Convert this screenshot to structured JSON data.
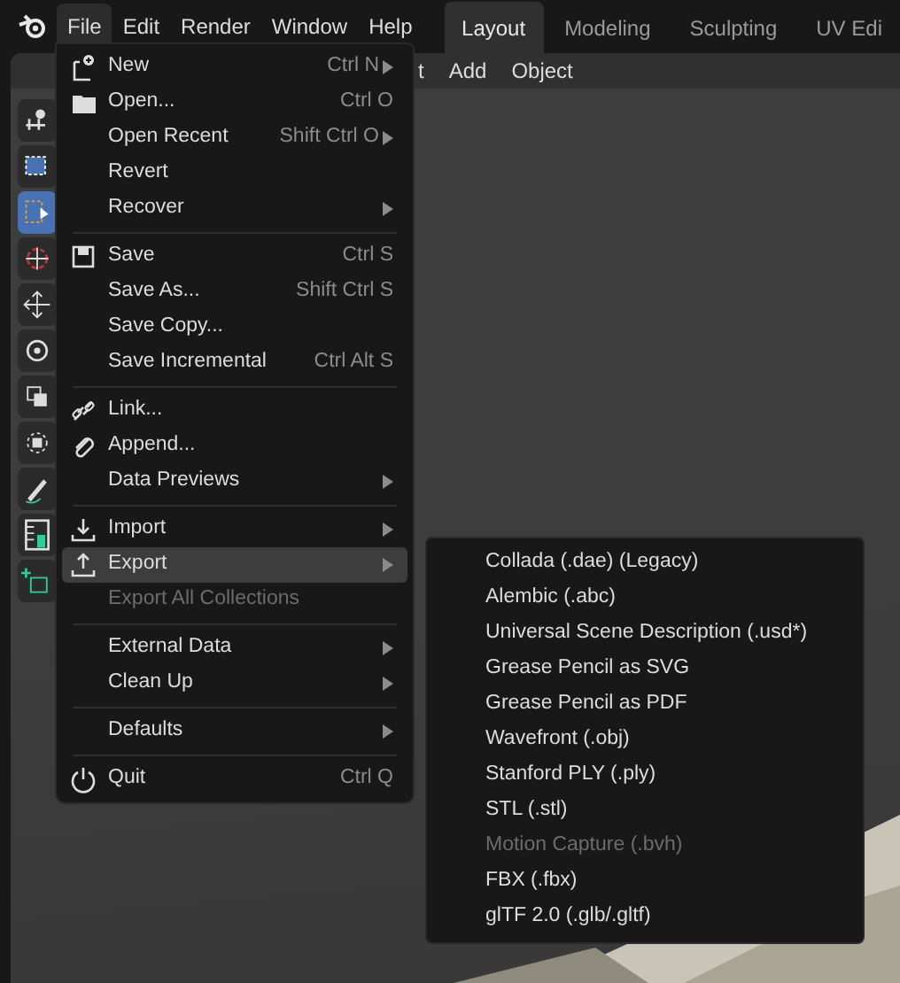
{
  "topbar": {
    "menus": [
      {
        "label": "File",
        "selected": true
      },
      {
        "label": "Edit",
        "selected": false
      },
      {
        "label": "Render",
        "selected": false
      },
      {
        "label": "Window",
        "selected": false
      },
      {
        "label": "Help",
        "selected": false
      }
    ],
    "workspaces": [
      {
        "label": "Layout",
        "selected": true
      },
      {
        "label": "Modeling",
        "selected": false
      },
      {
        "label": "Sculpting",
        "selected": false
      },
      {
        "label": "UV Edi",
        "selected": false
      }
    ]
  },
  "viewport_header": {
    "menus": [
      "t",
      "Add",
      "Object"
    ]
  },
  "toolbar": {
    "tools": [
      {
        "kind": "view",
        "selected": false
      },
      {
        "kind": "box",
        "selected": false
      },
      {
        "kind": "select",
        "selected": true
      },
      {
        "kind": "cursor",
        "selected": false
      },
      {
        "kind": "move",
        "selected": false
      },
      {
        "kind": "rotate",
        "selected": false
      },
      {
        "kind": "scale",
        "selected": false
      },
      {
        "kind": "transform",
        "selected": false
      },
      {
        "kind": "annotate",
        "selected": false
      },
      {
        "kind": "measure",
        "selected": false
      },
      {
        "kind": "add",
        "selected": false
      }
    ]
  },
  "file_menu": {
    "sections": [
      [
        {
          "label": "New",
          "kind": "new",
          "shortcut": "Ctrl N",
          "submenu": true,
          "disabled": false,
          "selected": false
        },
        {
          "label": "Open...",
          "kind": "folder",
          "shortcut": "Ctrl O",
          "submenu": false,
          "disabled": false,
          "selected": false
        },
        {
          "label": "Open Recent",
          "shortcut": "Shift Ctrl O",
          "submenu": true,
          "disabled": false,
          "selected": false
        },
        {
          "label": "Revert",
          "submenu": false,
          "disabled": false,
          "selected": false
        },
        {
          "label": "Recover",
          "submenu": true,
          "disabled": false,
          "selected": false
        }
      ],
      [
        {
          "label": "Save",
          "kind": "save",
          "shortcut": "Ctrl S",
          "submenu": false,
          "disabled": false,
          "selected": false
        },
        {
          "label": "Save As...",
          "shortcut": "Shift Ctrl S",
          "submenu": false,
          "disabled": false,
          "selected": false
        },
        {
          "label": "Save Copy...",
          "submenu": false,
          "disabled": false,
          "selected": false
        },
        {
          "label": "Save Incremental",
          "shortcut": "Ctrl Alt S",
          "submenu": false,
          "disabled": false,
          "selected": false
        }
      ],
      [
        {
          "label": "Link...",
          "kind": "link",
          "submenu": false,
          "disabled": false,
          "selected": false
        },
        {
          "label": "Append...",
          "kind": "clip",
          "submenu": false,
          "disabled": false,
          "selected": false
        },
        {
          "label": "Data Previews",
          "submenu": true,
          "disabled": false,
          "selected": false
        }
      ],
      [
        {
          "label": "Import",
          "kind": "import",
          "submenu": true,
          "disabled": false,
          "selected": false
        },
        {
          "label": "Export",
          "kind": "export",
          "submenu": true,
          "disabled": false,
          "selected": true
        },
        {
          "label": "Export All Collections",
          "submenu": false,
          "disabled": true,
          "selected": false
        }
      ],
      [
        {
          "label": "External Data",
          "submenu": true,
          "disabled": false,
          "selected": false
        },
        {
          "label": "Clean Up",
          "submenu": true,
          "disabled": false,
          "selected": false
        }
      ],
      [
        {
          "label": "Defaults",
          "submenu": true,
          "disabled": false,
          "selected": false
        }
      ],
      [
        {
          "label": "Quit",
          "kind": "power",
          "shortcut": "Ctrl Q",
          "submenu": false,
          "disabled": false,
          "selected": false
        }
      ]
    ]
  },
  "export_menu": {
    "items": [
      {
        "label": "Collada (.dae) (Legacy)",
        "disabled": false
      },
      {
        "label": "Alembic (.abc)",
        "disabled": false
      },
      {
        "label": "Universal Scene Description (.usd*)",
        "disabled": false
      },
      {
        "label": "Grease Pencil as SVG",
        "disabled": false
      },
      {
        "label": "Grease Pencil as PDF",
        "disabled": false
      },
      {
        "label": "Wavefront (.obj)",
        "disabled": false
      },
      {
        "label": "Stanford PLY (.ply)",
        "disabled": false
      },
      {
        "label": "STL (.stl)",
        "disabled": false
      },
      {
        "label": "Motion Capture (.bvh)",
        "disabled": true
      },
      {
        "label": "FBX (.fbx)",
        "disabled": false
      },
      {
        "label": "glTF 2.0 (.glb/.gltf)",
        "disabled": false
      }
    ]
  }
}
